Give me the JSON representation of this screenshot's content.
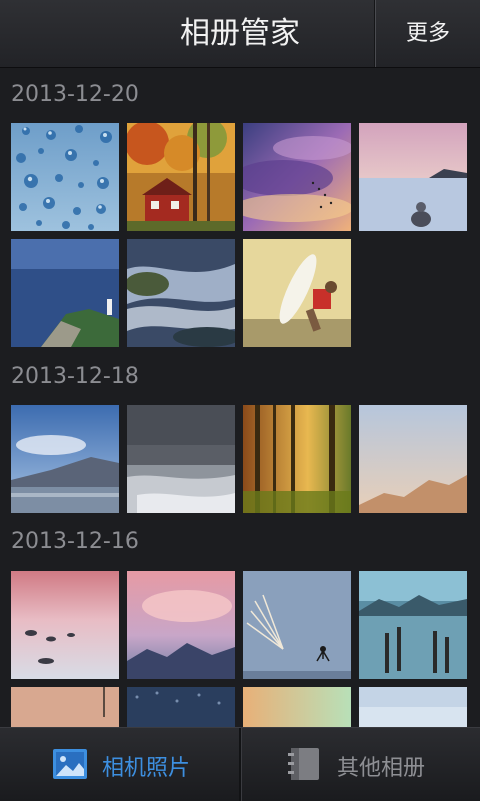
{
  "header": {
    "title": "相册管家",
    "more_label": "更多"
  },
  "sections": [
    {
      "date": "2013-12-20",
      "photo_count": 7
    },
    {
      "date": "2013-12-18",
      "photo_count": 4
    },
    {
      "date": "2013-12-16",
      "photo_count": 8
    }
  ],
  "tabbar": {
    "camera_photos_label": "相机照片",
    "other_albums_label": "其他相册",
    "active_color": "#3d8fe0"
  }
}
